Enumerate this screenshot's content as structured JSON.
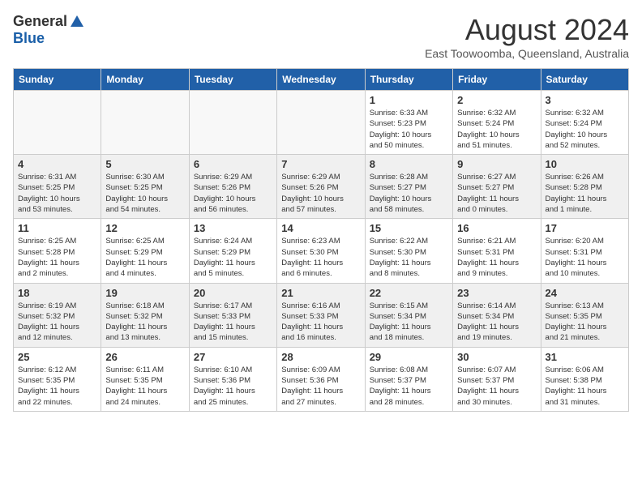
{
  "header": {
    "logo_general": "General",
    "logo_blue": "Blue",
    "month_year": "August 2024",
    "location": "East Toowoomba, Queensland, Australia"
  },
  "days_of_week": [
    "Sunday",
    "Monday",
    "Tuesday",
    "Wednesday",
    "Thursday",
    "Friday",
    "Saturday"
  ],
  "weeks": [
    {
      "shaded": false,
      "days": [
        {
          "num": "",
          "info": ""
        },
        {
          "num": "",
          "info": ""
        },
        {
          "num": "",
          "info": ""
        },
        {
          "num": "",
          "info": ""
        },
        {
          "num": "1",
          "info": "Sunrise: 6:33 AM\nSunset: 5:23 PM\nDaylight: 10 hours\nand 50 minutes."
        },
        {
          "num": "2",
          "info": "Sunrise: 6:32 AM\nSunset: 5:24 PM\nDaylight: 10 hours\nand 51 minutes."
        },
        {
          "num": "3",
          "info": "Sunrise: 6:32 AM\nSunset: 5:24 PM\nDaylight: 10 hours\nand 52 minutes."
        }
      ]
    },
    {
      "shaded": true,
      "days": [
        {
          "num": "4",
          "info": "Sunrise: 6:31 AM\nSunset: 5:25 PM\nDaylight: 10 hours\nand 53 minutes."
        },
        {
          "num": "5",
          "info": "Sunrise: 6:30 AM\nSunset: 5:25 PM\nDaylight: 10 hours\nand 54 minutes."
        },
        {
          "num": "6",
          "info": "Sunrise: 6:29 AM\nSunset: 5:26 PM\nDaylight: 10 hours\nand 56 minutes."
        },
        {
          "num": "7",
          "info": "Sunrise: 6:29 AM\nSunset: 5:26 PM\nDaylight: 10 hours\nand 57 minutes."
        },
        {
          "num": "8",
          "info": "Sunrise: 6:28 AM\nSunset: 5:27 PM\nDaylight: 10 hours\nand 58 minutes."
        },
        {
          "num": "9",
          "info": "Sunrise: 6:27 AM\nSunset: 5:27 PM\nDaylight: 11 hours\nand 0 minutes."
        },
        {
          "num": "10",
          "info": "Sunrise: 6:26 AM\nSunset: 5:28 PM\nDaylight: 11 hours\nand 1 minute."
        }
      ]
    },
    {
      "shaded": false,
      "days": [
        {
          "num": "11",
          "info": "Sunrise: 6:25 AM\nSunset: 5:28 PM\nDaylight: 11 hours\nand 2 minutes."
        },
        {
          "num": "12",
          "info": "Sunrise: 6:25 AM\nSunset: 5:29 PM\nDaylight: 11 hours\nand 4 minutes."
        },
        {
          "num": "13",
          "info": "Sunrise: 6:24 AM\nSunset: 5:29 PM\nDaylight: 11 hours\nand 5 minutes."
        },
        {
          "num": "14",
          "info": "Sunrise: 6:23 AM\nSunset: 5:30 PM\nDaylight: 11 hours\nand 6 minutes."
        },
        {
          "num": "15",
          "info": "Sunrise: 6:22 AM\nSunset: 5:30 PM\nDaylight: 11 hours\nand 8 minutes."
        },
        {
          "num": "16",
          "info": "Sunrise: 6:21 AM\nSunset: 5:31 PM\nDaylight: 11 hours\nand 9 minutes."
        },
        {
          "num": "17",
          "info": "Sunrise: 6:20 AM\nSunset: 5:31 PM\nDaylight: 11 hours\nand 10 minutes."
        }
      ]
    },
    {
      "shaded": true,
      "days": [
        {
          "num": "18",
          "info": "Sunrise: 6:19 AM\nSunset: 5:32 PM\nDaylight: 11 hours\nand 12 minutes."
        },
        {
          "num": "19",
          "info": "Sunrise: 6:18 AM\nSunset: 5:32 PM\nDaylight: 11 hours\nand 13 minutes."
        },
        {
          "num": "20",
          "info": "Sunrise: 6:17 AM\nSunset: 5:33 PM\nDaylight: 11 hours\nand 15 minutes."
        },
        {
          "num": "21",
          "info": "Sunrise: 6:16 AM\nSunset: 5:33 PM\nDaylight: 11 hours\nand 16 minutes."
        },
        {
          "num": "22",
          "info": "Sunrise: 6:15 AM\nSunset: 5:34 PM\nDaylight: 11 hours\nand 18 minutes."
        },
        {
          "num": "23",
          "info": "Sunrise: 6:14 AM\nSunset: 5:34 PM\nDaylight: 11 hours\nand 19 minutes."
        },
        {
          "num": "24",
          "info": "Sunrise: 6:13 AM\nSunset: 5:35 PM\nDaylight: 11 hours\nand 21 minutes."
        }
      ]
    },
    {
      "shaded": false,
      "days": [
        {
          "num": "25",
          "info": "Sunrise: 6:12 AM\nSunset: 5:35 PM\nDaylight: 11 hours\nand 22 minutes."
        },
        {
          "num": "26",
          "info": "Sunrise: 6:11 AM\nSunset: 5:35 PM\nDaylight: 11 hours\nand 24 minutes."
        },
        {
          "num": "27",
          "info": "Sunrise: 6:10 AM\nSunset: 5:36 PM\nDaylight: 11 hours\nand 25 minutes."
        },
        {
          "num": "28",
          "info": "Sunrise: 6:09 AM\nSunset: 5:36 PM\nDaylight: 11 hours\nand 27 minutes."
        },
        {
          "num": "29",
          "info": "Sunrise: 6:08 AM\nSunset: 5:37 PM\nDaylight: 11 hours\nand 28 minutes."
        },
        {
          "num": "30",
          "info": "Sunrise: 6:07 AM\nSunset: 5:37 PM\nDaylight: 11 hours\nand 30 minutes."
        },
        {
          "num": "31",
          "info": "Sunrise: 6:06 AM\nSunset: 5:38 PM\nDaylight: 11 hours\nand 31 minutes."
        }
      ]
    }
  ]
}
